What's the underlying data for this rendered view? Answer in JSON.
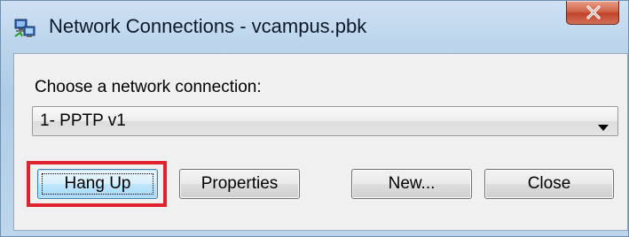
{
  "window": {
    "title": "Network Connections - vcampus.pbk",
    "app_icon": "network-connections-icon",
    "close_icon": "close-x-icon"
  },
  "dialog": {
    "prompt_label": "Choose a network connection:",
    "connection_select": {
      "selected_value": "1- PPTP v1",
      "arrow_icon": "dropdown-arrow-icon"
    },
    "buttons": {
      "hang_up": "Hang Up",
      "properties": "Properties",
      "new": "New...",
      "close": "Close"
    },
    "highlight_color": "#e0232e"
  }
}
